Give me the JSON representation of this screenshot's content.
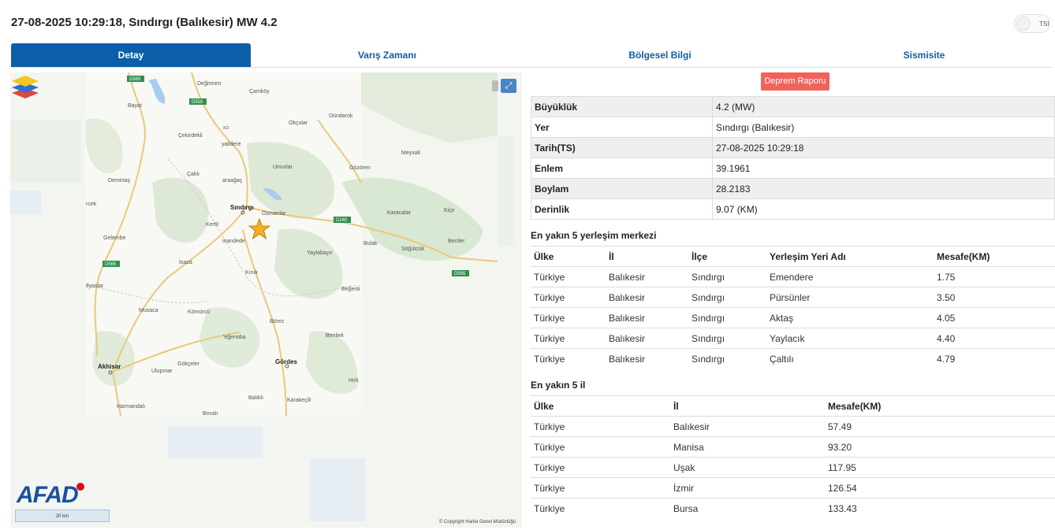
{
  "header": {
    "title": "27-08-2025 10:29:18, Sındırgı (Balıkesir) MW 4.2",
    "toggle_label": "TSI"
  },
  "tabs": [
    "Detay",
    "Varış Zamanı",
    "Bölgesel Bilgi",
    "Sismisite"
  ],
  "report_button": "Deprem Raporu",
  "map": {
    "copyright": "© Copyright Harita Genel Müdürlüğü",
    "scale_label": "20 km",
    "logo": "AFAD",
    "road_labels": [
      "D565",
      "D555",
      "D240",
      "D585",
      "D565"
    ],
    "place_labels": [
      "Değirmen",
      "Çamköy",
      "Bayat",
      "Dündarok",
      "Okçular",
      "Çekirdekli",
      "ıcı",
      "yalidere",
      "Meyvali",
      "Çaklı",
      "Umurlar",
      "Gözören",
      "Demirtaş",
      "araağaç",
      "Sındırgı",
      "Osmanlar",
      "Karacalar",
      "Kiçir",
      "rcek",
      "Kertil",
      "inandede",
      "Gelembe",
      "Bulak",
      "Söğütcük",
      "Beciler",
      "Yaylabayır",
      "İsaca",
      "Kınık",
      "Beğenli",
      "Ilyaslar",
      "Musaca",
      "Kömürcü",
      "Börez",
      "Benlieli",
      "'eğenoba",
      "Akhisar",
      "Gökçeler",
      "Ulupınar",
      "Gördes",
      "Hırk",
      "Harmandalı",
      "Balıklı",
      "Karakeçili",
      "Bovalı"
    ]
  },
  "details": [
    {
      "key": "Büyüklük",
      "value": "4.2 (MW)"
    },
    {
      "key": "Yer",
      "value": "Sındırgı (Balıkesir)"
    },
    {
      "key": "Tarih(TS)",
      "value": "27-08-2025 10:29:18"
    },
    {
      "key": "Enlem",
      "value": "39.1961"
    },
    {
      "key": "Boylam",
      "value": "28.2183"
    },
    {
      "key": "Derinlik",
      "value": "9.07 (KM)"
    }
  ],
  "settlements": {
    "title": "En yakın 5 yerleşim merkezi",
    "headers": [
      "Ülke",
      "İl",
      "İlçe",
      "Yerleşim Yeri Adı",
      "Mesafe(KM)"
    ],
    "rows": [
      [
        "Türkiye",
        "Balıkesir",
        "Sındırgı",
        "Emendere",
        "1.75"
      ],
      [
        "Türkiye",
        "Balıkesir",
        "Sındırgı",
        "Pürsünler",
        "3.50"
      ],
      [
        "Türkiye",
        "Balıkesir",
        "Sındırgı",
        "Aktaş",
        "4.05"
      ],
      [
        "Türkiye",
        "Balıkesir",
        "Sındırgı",
        "Yaylacık",
        "4.40"
      ],
      [
        "Türkiye",
        "Balıkesir",
        "Sındırgı",
        "Çaltılı",
        "4.79"
      ]
    ]
  },
  "provinces": {
    "title": "En yakın 5 il",
    "headers": [
      "Ülke",
      "İl",
      "Mesafe(KM)"
    ],
    "rows": [
      [
        "Türkiye",
        "Balıkesir",
        "57.49"
      ],
      [
        "Türkiye",
        "Manisa",
        "93.20"
      ],
      [
        "Türkiye",
        "Uşak",
        "117.95"
      ],
      [
        "Türkiye",
        "İzmir",
        "126.54"
      ],
      [
        "Türkiye",
        "Bursa",
        "133.43"
      ]
    ]
  },
  "colors": {
    "accent": "#0d5ea8",
    "report": "#f0625a",
    "star": "#f2b01e"
  }
}
